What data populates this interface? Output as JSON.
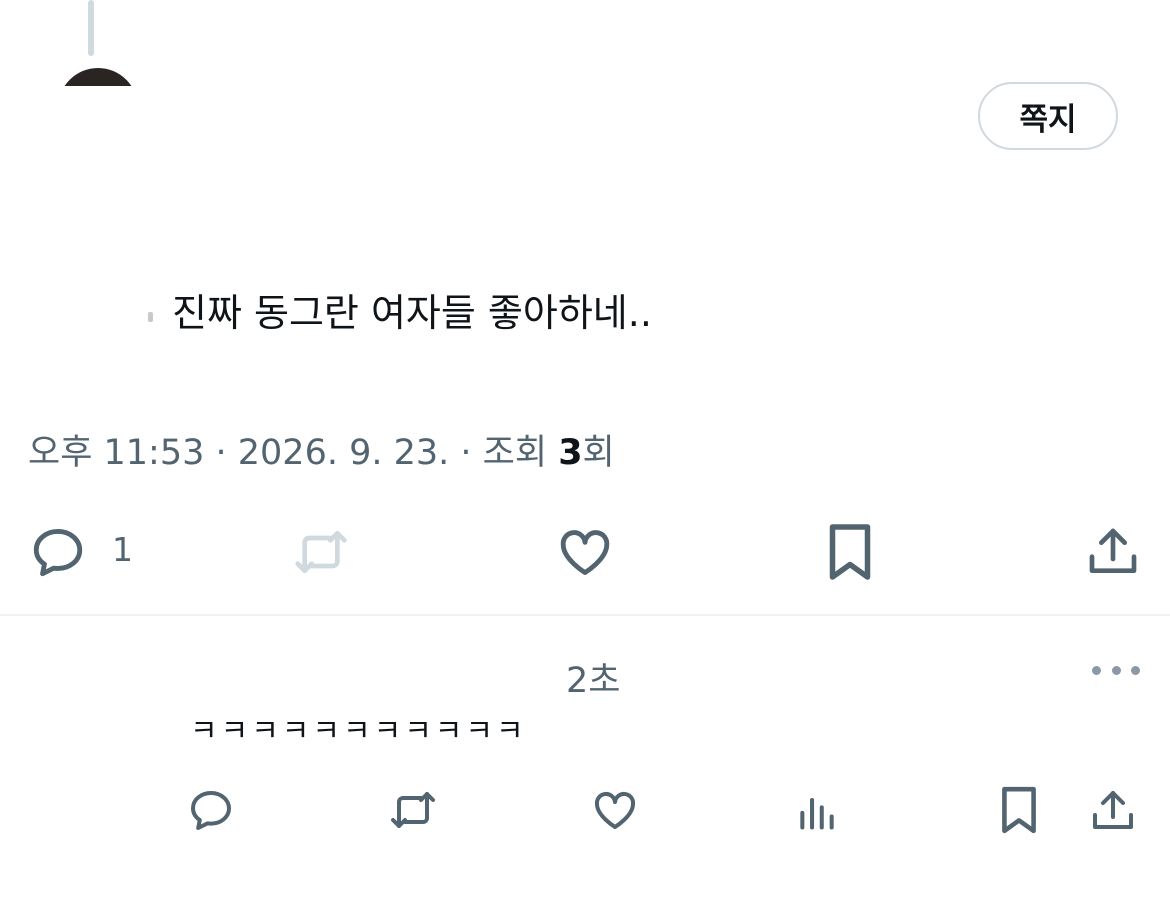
{
  "dm_button_label": "쪽지",
  "tweet": {
    "text": "진짜 동그란 여자들 좋아하네..",
    "meta_prefix": "오후 11:53 · 2026. 9. 23. · 조회 ",
    "views_count": "3",
    "views_suffix": "회",
    "reply_count": "1"
  },
  "reply": {
    "time": "2초",
    "text": "ㅋㅋㅋㅋㅋㅋㅋㅋㅋㅋㅋ"
  },
  "colors": {
    "icon": "#536471",
    "icon_disabled": "#cfd9de",
    "text_secondary": "#536471",
    "text_primary": "#0f1419",
    "border": "#cfd9de",
    "divider": "#eff3f4"
  },
  "icons": {
    "reply": "speech-bubble-icon",
    "retweet": "retweet-icon",
    "like": "heart-icon",
    "bookmark": "bookmark-icon",
    "share": "share-icon",
    "views": "bar-chart-icon",
    "more": "more-dots-icon"
  }
}
